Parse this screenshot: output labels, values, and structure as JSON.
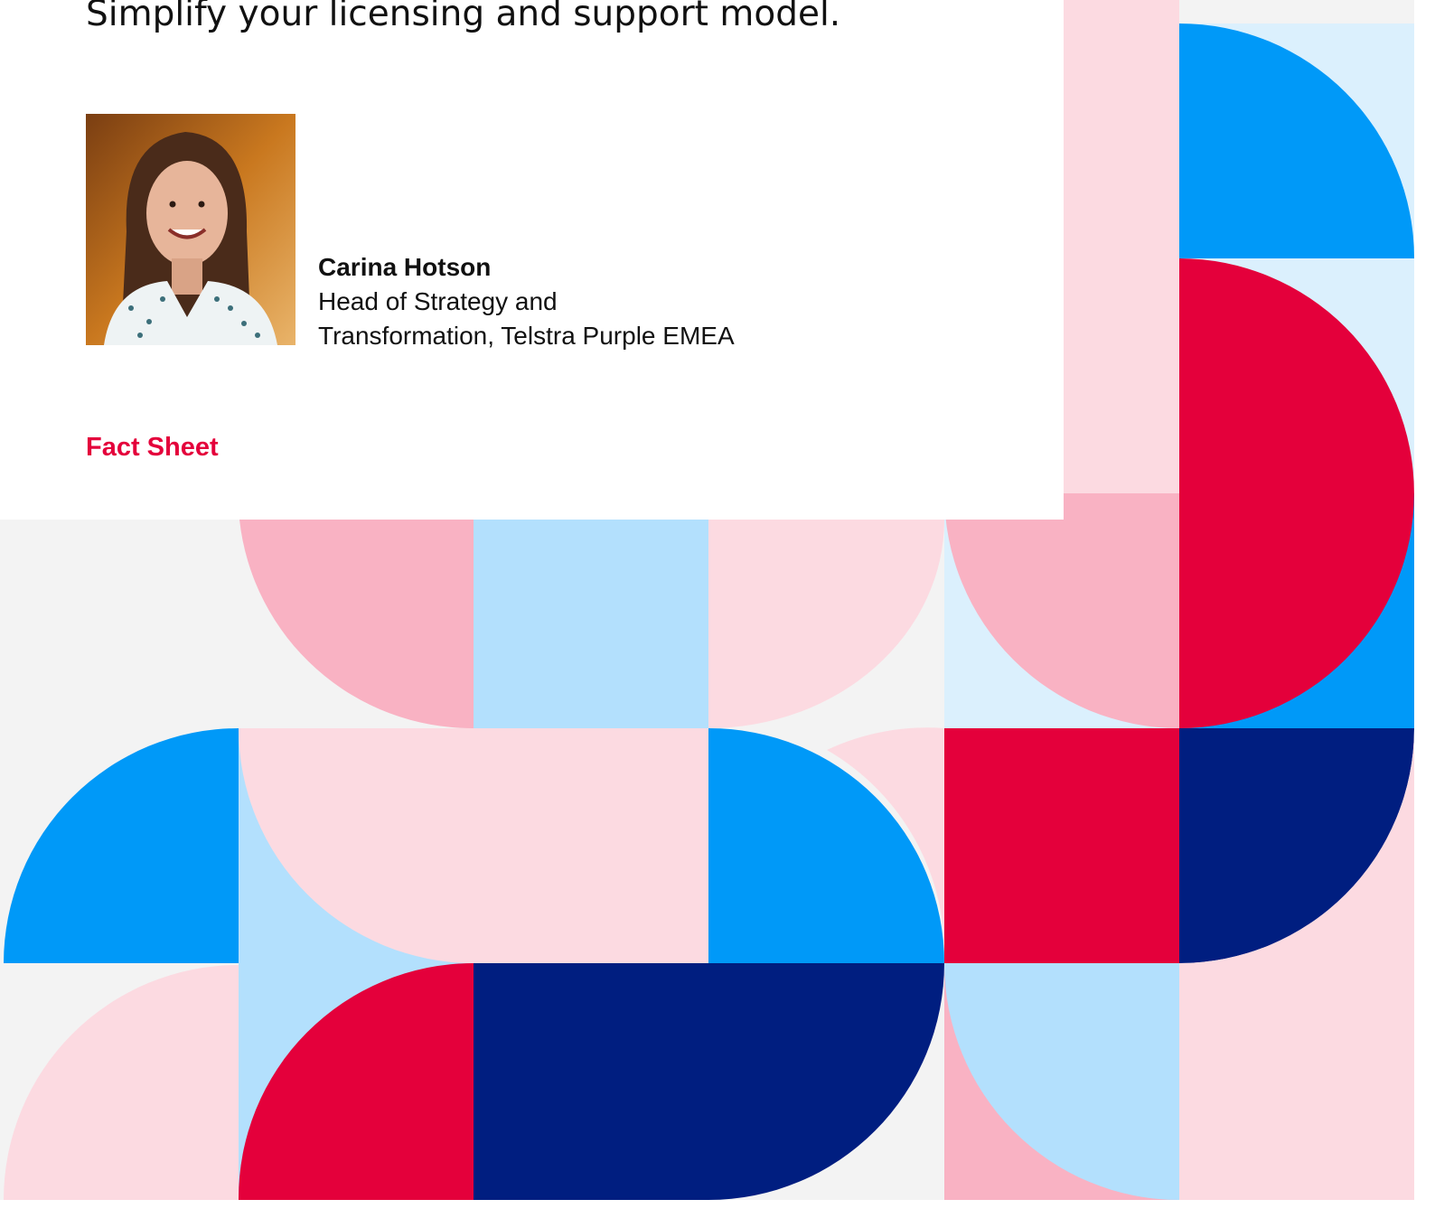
{
  "headline": "Simplify your licensing and support model.",
  "person": {
    "name": "Carina Hotson",
    "title_line1": "Head of Strategy and",
    "title_line2": "Transformation, Telstra Purple EMEA"
  },
  "doc_type": "Fact Sheet",
  "colors": {
    "brand_red": "#e4003b",
    "pink": "#f9b2c3",
    "light_pink": "#fcdae1",
    "blue": "#0099f8",
    "light_blue": "#b3e0fd",
    "pale_blue": "#dbf0fd",
    "navy": "#001e80",
    "light_gray": "#f3f3f3"
  }
}
